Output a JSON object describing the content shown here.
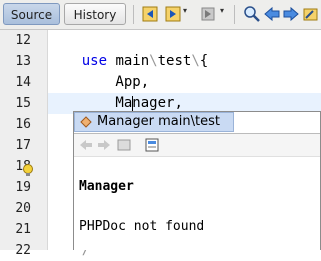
{
  "tabs": [
    {
      "label": "Source",
      "active": true
    },
    {
      "label": "History",
      "active": false
    }
  ],
  "toolbar_icons": [
    "back-icon",
    "forward-icon",
    "toggle-bookmark-icon",
    "dropdown-arrow-icon",
    "find-icon",
    "find-previous-icon",
    "find-next-icon",
    "toggle-highlight-icon"
  ],
  "editor": {
    "line_numbers": [
      "12",
      "13",
      "14",
      "15",
      "16",
      "17",
      "18",
      "19",
      "20",
      "21",
      "22"
    ],
    "code_lines": [
      "",
      "use main\\test\\{",
      "    App,",
      "    Manager,",
      "",
      "",
      "",
      "",
      "",
      "}",
      "/*"
    ],
    "current_line": "15"
  },
  "completion": {
    "item": "Manager main\\test",
    "doc_title": "Manager",
    "doc_message": "PHPDoc not found"
  },
  "colors": {
    "keyword": "#0000e6",
    "separator": "#999999",
    "selection": "#c9daf3",
    "current_line": "#e8f2fe"
  }
}
